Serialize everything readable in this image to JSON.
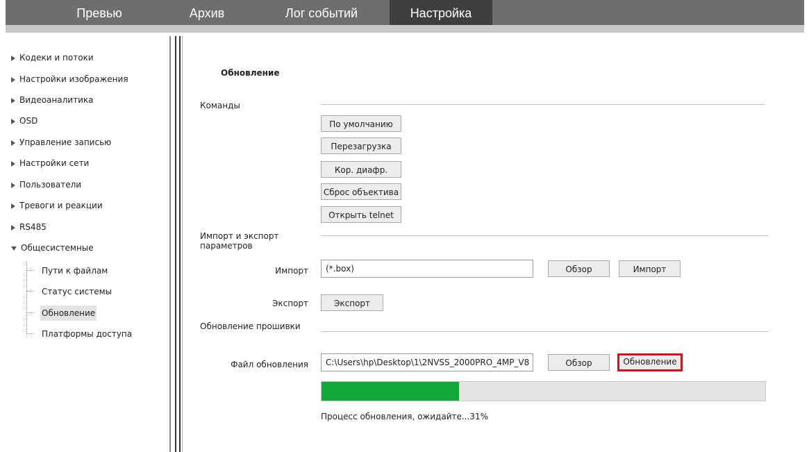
{
  "tabs": [
    {
      "label": "Превью",
      "active": false
    },
    {
      "label": "Архив",
      "active": false
    },
    {
      "label": "Лог событий",
      "active": false
    },
    {
      "label": "Настройка",
      "active": true
    }
  ],
  "sidebar": {
    "items": [
      {
        "label": "Кодеки и потоки",
        "expanded": false
      },
      {
        "label": "Настройки изображения",
        "expanded": false
      },
      {
        "label": "Видеоаналитика",
        "expanded": false
      },
      {
        "label": "OSD",
        "expanded": false
      },
      {
        "label": "Управление записью",
        "expanded": false
      },
      {
        "label": "Настройки сети",
        "expanded": false
      },
      {
        "label": "Пользователи",
        "expanded": false
      },
      {
        "label": "Тревоги и реакции",
        "expanded": false
      },
      {
        "label": "RS485",
        "expanded": false
      },
      {
        "label": "Общесистемные",
        "expanded": true
      }
    ],
    "subitems": [
      {
        "label": "Пути к файлам",
        "selected": false
      },
      {
        "label": "Статус системы",
        "selected": false
      },
      {
        "label": "Обновление",
        "selected": true
      },
      {
        "label": "Платформы доступа",
        "selected": false
      }
    ]
  },
  "main": {
    "title": "Обновление",
    "commands": {
      "label": "Команды",
      "buttons": [
        "По умолчанию",
        "Перезагрузка",
        "Кор. диафр.",
        "Сброс объектива",
        "Открыть telnet"
      ]
    },
    "import_export": {
      "label": "Импорт и экспорт параметров",
      "import_label": "Импорт",
      "import_value": "(*.box)",
      "browse_label": "Обзор",
      "import_button": "Импорт",
      "export_label": "Экспорт",
      "export_button": "Экспорт"
    },
    "firmware": {
      "label": "Обновление прошивки",
      "file_label": "Файл обновления",
      "file_value": "C:\\Users\\hp\\Desktop\\1\\2NVSS_2000PRO_4MP_V8",
      "browse_label": "Обзор",
      "update_button": "Обновление",
      "progress_percent": 31,
      "status_text": "Процесс обновления, ожидайте...31%"
    }
  },
  "colors": {
    "topbar": "#6e6e6e",
    "active_tab": "#3e3e3e",
    "progress_fill": "#10a93a",
    "highlight_border": "#d8101a"
  }
}
